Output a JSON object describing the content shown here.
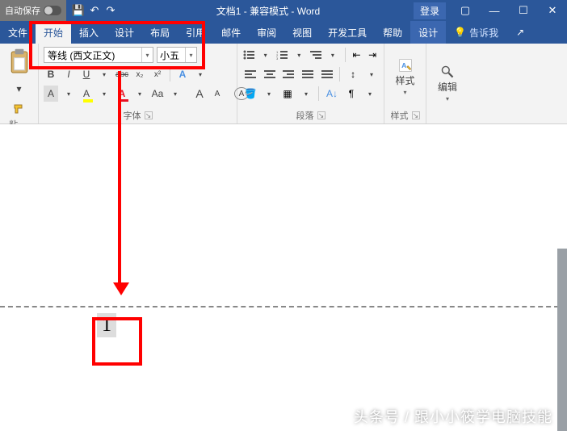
{
  "titlebar": {
    "autosave_label": "自动保存",
    "doc_title": "文档1 - 兼容模式 - Word",
    "login_label": "登录"
  },
  "tabs": {
    "file": "文件",
    "home": "开始",
    "insert": "插入",
    "design": "设计",
    "layout": "布局",
    "references": "引用",
    "mail": "邮件",
    "review": "审阅",
    "view": "视图",
    "dev": "开发工具",
    "help": "帮助",
    "design2": "设计",
    "tellme": "告诉我"
  },
  "clipboard": {
    "label": "粘贴板"
  },
  "font": {
    "name": "等线 (西文正文)",
    "size": "小五",
    "label": "字体",
    "bold": "B",
    "italic": "I",
    "underline": "U",
    "strike": "abc",
    "sub": "x₂",
    "sup": "x²",
    "caseA": "A",
    "clear": "A",
    "fontcolorA": "A",
    "aa": "Aa",
    "Abig": "A",
    "Asmall": "A",
    "Acirc": "A"
  },
  "paragraph": {
    "label": "段落"
  },
  "styles": {
    "label": "样式"
  },
  "editing": {
    "label": "编辑"
  },
  "document": {
    "page_number": "1"
  },
  "watermark": "头条号 / 跟小小筱学电脑技能",
  "chart_data": null
}
